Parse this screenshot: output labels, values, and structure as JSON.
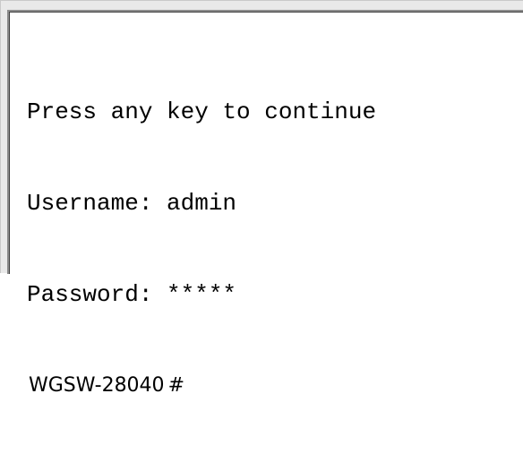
{
  "terminal": {
    "lines": [
      "Press any key to continue",
      "Username: admin",
      "Password: *****"
    ],
    "prompt": {
      "hostname": "WGSW-28040",
      "symbol": "#"
    }
  }
}
